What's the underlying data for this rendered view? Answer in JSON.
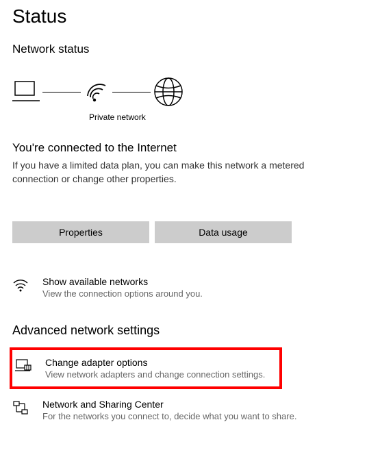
{
  "title": "Status",
  "network_status": {
    "heading": "Network status",
    "diagram_label": "Private network"
  },
  "connection": {
    "heading": "You're connected to the Internet",
    "body": "If you have a limited data plan, you can make this network a metered connection or change other properties."
  },
  "buttons": {
    "properties": "Properties",
    "data_usage": "Data usage"
  },
  "available": {
    "title": "Show available networks",
    "desc": "View the connection options around you."
  },
  "advanced": {
    "heading": "Advanced network settings",
    "adapter": {
      "title": "Change adapter options",
      "desc": "View network adapters and change connection settings."
    },
    "sharing": {
      "title": "Network and Sharing Center",
      "desc": "For the networks you connect to, decide what you want to share."
    }
  }
}
